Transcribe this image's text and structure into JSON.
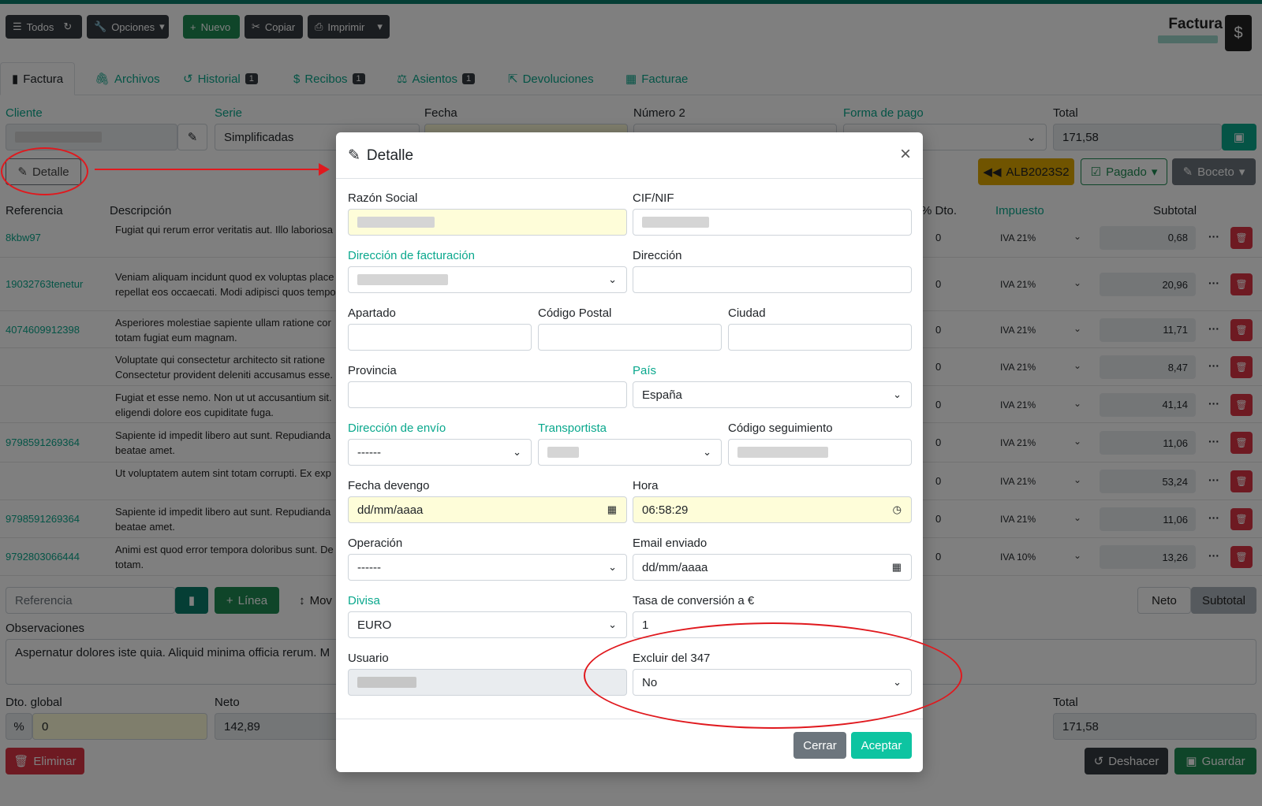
{
  "toolbar": {
    "todos": "Todos",
    "opciones": "Opciones",
    "nuevo": "Nuevo",
    "copiar": "Copiar",
    "imprimir": "Imprimir"
  },
  "page": {
    "title": "Factura"
  },
  "tabs": [
    {
      "label": "Factura"
    },
    {
      "label": "Archivos"
    },
    {
      "label": "Historial",
      "badge": "1"
    },
    {
      "label": "Recibos",
      "badge": "1"
    },
    {
      "label": "Asientos",
      "badge": "1"
    },
    {
      "label": "Devoluciones"
    },
    {
      "label": "Facturae"
    }
  ],
  "header": {
    "cliente": "Cliente",
    "serie": "Serie",
    "serie_value": "Simplificadas",
    "fecha": "Fecha",
    "numero2": "Número 2",
    "forma_pago": "Forma de pago",
    "total": "Total",
    "total_value": "171,58"
  },
  "actions": {
    "detalle": "Detalle",
    "albaran": "ALB2023S2",
    "pagado": "Pagado",
    "boceto": "Boceto"
  },
  "lines_header": {
    "referencia": "Referencia",
    "descripcion": "Descripción",
    "dto": "% Dto.",
    "impuesto": "Impuesto",
    "subtotal": "Subtotal"
  },
  "lines": [
    {
      "ref": "8kbw97",
      "desc1": "Fugiat qui rerum error veritatis aut. Illo laboriosa",
      "desc2": "",
      "dto": "0",
      "iva": "IVA 21%",
      "subtotal": "0,68"
    },
    {
      "ref": "19032763tenetur",
      "desc1": "Veniam aliquam incidunt quod ex voluptas place",
      "desc2": "repellat eos occaecati. Modi adipisci quos tempo",
      "dto": "0",
      "iva": "IVA 21%",
      "subtotal": "20,96"
    },
    {
      "ref": "4074609912398",
      "desc1": "Asperiores molestiae sapiente ullam ratione cor",
      "desc2": "totam fugiat eum magnam.",
      "dto": "0",
      "iva": "IVA 21%",
      "subtotal": "11,71"
    },
    {
      "ref": "",
      "desc1": "Voluptate qui consectetur architecto sit ratione",
      "desc2": "Consectetur provident deleniti accusamus esse.",
      "dto": "0",
      "iva": "IVA 21%",
      "subtotal": "8,47"
    },
    {
      "ref": "",
      "desc1": "Fugiat et esse nemo. Non ut ut accusantium sit.",
      "desc2": "eligendi dolore eos cupiditate fuga.",
      "dto": "0",
      "iva": "IVA 21%",
      "subtotal": "41,14"
    },
    {
      "ref": "9798591269364",
      "desc1": "Sapiente id impedit libero aut sunt. Repudianda",
      "desc2": "beatae amet.",
      "dto": "0",
      "iva": "IVA 21%",
      "subtotal": "11,06"
    },
    {
      "ref": "",
      "desc1": "Ut voluptatem autem sint totam corrupti. Ex exp",
      "desc2": "",
      "dto": "0",
      "iva": "IVA 21%",
      "subtotal": "53,24"
    },
    {
      "ref": "9798591269364",
      "desc1": "Sapiente id impedit libero aut sunt. Repudianda",
      "desc2": "beatae amet.",
      "dto": "0",
      "iva": "IVA 21%",
      "subtotal": "11,06"
    },
    {
      "ref": "9792803066444",
      "desc1": "Animi est quod error tempora doloribus sunt. De",
      "desc2": "totam.",
      "dto": "0",
      "iva": "IVA 10%",
      "subtotal": "13,26"
    }
  ],
  "bottom": {
    "referencia_placeholder": "Referencia",
    "linea": "Línea",
    "mover": "Mov",
    "neto_btn": "Neto",
    "subtotal_btn": "Subtotal",
    "observaciones": "Observaciones",
    "observaciones_text": "Aspernatur dolores iste quia. Aliquid minima officia rerum. M",
    "dto_global": "Dto. global",
    "dto_global_value": "0",
    "neto": "Neto",
    "neto_value": "142,89",
    "total": "Total",
    "total_value": "171,58",
    "eliminar": "Eliminar",
    "deshacer": "Deshacer",
    "guardar": "Guardar"
  },
  "modal": {
    "title": "Detalle",
    "razon_social": "Razón Social",
    "cif": "CIF/NIF",
    "dir_facturacion": "Dirección de facturación",
    "direccion": "Dirección",
    "apartado": "Apartado",
    "codigo_postal": "Código Postal",
    "ciudad": "Ciudad",
    "provincia": "Provincia",
    "pais": "País",
    "pais_value": "España",
    "dir_envio": "Dirección de envío",
    "dir_envio_value": "------",
    "transportista": "Transportista",
    "codigo_seguimiento": "Código seguimiento",
    "fecha_devengo": "Fecha devengo",
    "fecha_devengo_value": "dd/mm/aaaa",
    "hora": "Hora",
    "hora_value": "06:58:29",
    "operacion": "Operación",
    "operacion_value": "------",
    "email_enviado": "Email enviado",
    "email_enviado_value": "dd/mm/aaaa",
    "divisa": "Divisa",
    "divisa_value": "EURO",
    "tasa": "Tasa de conversión a €",
    "tasa_value": "1",
    "usuario": "Usuario",
    "excluir": "Excluir del 347",
    "excluir_value": "No",
    "cerrar": "Cerrar",
    "aceptar": "Aceptar"
  }
}
